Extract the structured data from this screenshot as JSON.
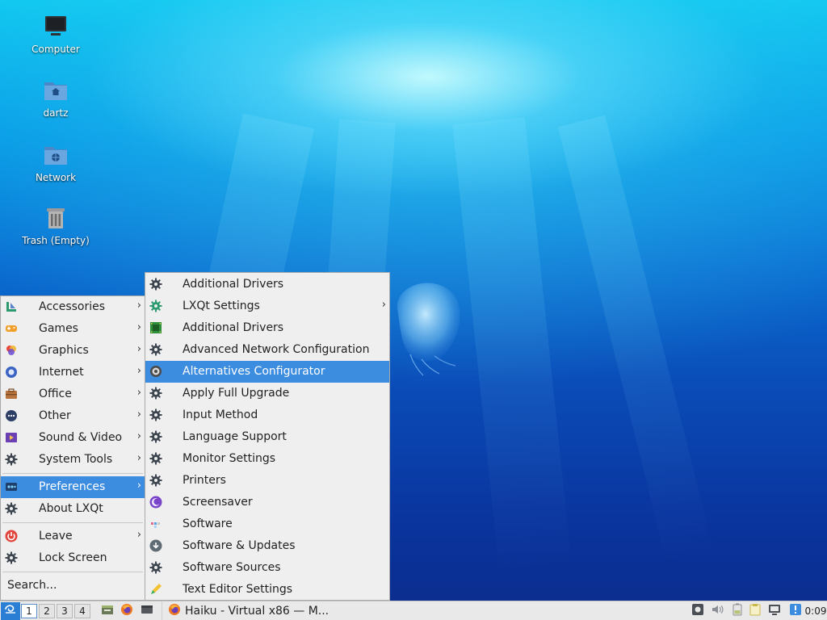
{
  "desktop": {
    "icons": [
      {
        "label": "Computer",
        "icon": "computer-icon"
      },
      {
        "label": "dartz",
        "icon": "home-folder-icon"
      },
      {
        "label": "Network",
        "icon": "network-folder-icon"
      },
      {
        "label": "Trash (Empty)",
        "icon": "trash-icon"
      }
    ]
  },
  "main_menu": {
    "items": [
      {
        "label": "Accessories",
        "icon": "accessories-icon",
        "submenu": true
      },
      {
        "label": "Games",
        "icon": "games-icon",
        "submenu": true
      },
      {
        "label": "Graphics",
        "icon": "graphics-icon",
        "submenu": true
      },
      {
        "label": "Internet",
        "icon": "internet-icon",
        "submenu": true
      },
      {
        "label": "Office",
        "icon": "office-icon",
        "submenu": true
      },
      {
        "label": "Other",
        "icon": "other-icon",
        "submenu": true
      },
      {
        "label": "Sound & Video",
        "icon": "sound-video-icon",
        "submenu": true
      },
      {
        "label": "System Tools",
        "icon": "gear-icon",
        "submenu": true
      },
      {
        "label": "Preferences",
        "icon": "preferences-icon",
        "submenu": true,
        "active": true
      },
      {
        "label": "About LXQt",
        "icon": "gear-icon",
        "submenu": false
      },
      {
        "label": "Leave",
        "icon": "power-icon",
        "submenu": true
      },
      {
        "label": "Lock Screen",
        "icon": "gear-icon",
        "submenu": false
      }
    ],
    "search_label": "Search..."
  },
  "preferences_menu": {
    "items": [
      {
        "label": "Additional Drivers",
        "icon": "gear-icon"
      },
      {
        "label": "LXQt Settings",
        "icon": "lxqt-icon",
        "submenu": true
      },
      {
        "label": "Additional Drivers",
        "icon": "chip-icon"
      },
      {
        "label": "Advanced Network Configuration",
        "icon": "gear-icon"
      },
      {
        "label": "Alternatives Configurator",
        "icon": "alternatives-icon",
        "active": true
      },
      {
        "label": "Apply Full Upgrade",
        "icon": "gear-icon"
      },
      {
        "label": "Input Method",
        "icon": "gear-icon"
      },
      {
        "label": "Language Support",
        "icon": "gear-icon"
      },
      {
        "label": "Monitor Settings",
        "icon": "gear-icon"
      },
      {
        "label": "Printers",
        "icon": "gear-icon"
      },
      {
        "label": "Screensaver",
        "icon": "screensaver-icon"
      },
      {
        "label": "Software",
        "icon": "software-icon"
      },
      {
        "label": "Software & Updates",
        "icon": "updates-icon"
      },
      {
        "label": "Software Sources",
        "icon": "gear-icon"
      },
      {
        "label": "Text Editor Settings",
        "icon": "text-editor-icon"
      }
    ]
  },
  "taskbar": {
    "workspaces": [
      "1",
      "2",
      "3",
      "4"
    ],
    "current_workspace": "1",
    "task_title": "Haiku - Virtual x86 — M...",
    "clock": "0:09"
  },
  "colors": {
    "highlight": "#3c8de0",
    "menu_bg": "#efefef",
    "taskbar_bg": "#e9e9e9"
  }
}
